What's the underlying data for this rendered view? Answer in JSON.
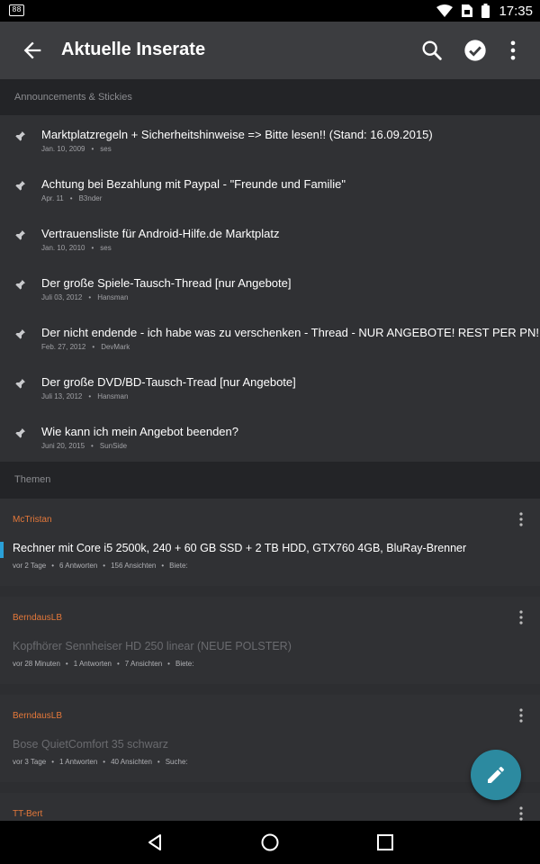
{
  "status_bar": {
    "left_icon": "88",
    "time": "17:35",
    "icons": [
      "wifi-icon",
      "sim-icon",
      "battery-icon"
    ]
  },
  "app_bar": {
    "title": "Aktuelle Inserate",
    "actions": [
      "search-icon",
      "check-circle-icon",
      "more-vert-icon"
    ]
  },
  "announcements": {
    "header": "Announcements & Stickies",
    "items": [
      {
        "title": "Marktplatzregeln + Sicherheitshinweise => Bitte lesen!! (Stand: 16.09.2015)",
        "date": "Jan. 10, 2009",
        "author": "ses"
      },
      {
        "title": "Achtung bei Bezahlung mit Paypal -  \"Freunde und Familie\"",
        "date": "Apr. 11",
        "author": "B3nder"
      },
      {
        "title": "Vertrauensliste für Android-Hilfe.de Marktplatz",
        "date": "Jan. 10, 2010",
        "author": "ses"
      },
      {
        "title": "Der große Spiele-Tausch-Thread [nur Angebote]",
        "date": "Juli 03, 2012",
        "author": "Hansman"
      },
      {
        "title": "Der nicht endende - ich habe was zu verschenken - Thread - NUR ANGEBOTE! REST PER PN!",
        "date": "Feb. 27, 2012",
        "author": "DevMark"
      },
      {
        "title": "Der große DVD/BD-Tausch-Tread [nur Angebote]",
        "date": "Juli 13, 2012",
        "author": "Hansman"
      },
      {
        "title": "Wie kann ich mein Angebot beenden?",
        "date": "Juni 20, 2015",
        "author": "SunSide"
      }
    ]
  },
  "themes": {
    "header": "Themen",
    "items": [
      {
        "author": "McTristan",
        "title": "Rechner mit Core i5 2500k, 240 + 60 GB SSD + 2 TB HDD, GTX760 4GB, BluRay-Brenner",
        "age": "vor 2 Tage",
        "replies": "6 Antworten",
        "views": "156 Ansichten",
        "type": "Biete:",
        "read": false
      },
      {
        "author": "BerndausLB",
        "title": "Kopfhörer Sennheiser HD 250 linear (NEUE POLSTER)",
        "age": "vor 28 Minuten",
        "replies": "1 Antworten",
        "views": "7 Ansichten",
        "type": "Biete:",
        "read": true
      },
      {
        "author": "BerndausLB",
        "title": "Bose QuietComfort 35 schwarz",
        "age": "vor 3 Tage",
        "replies": "1 Antworten",
        "views": "40 Ansichten",
        "type": "Suche:",
        "read": true
      },
      {
        "author": "TT-Bert",
        "title": "",
        "age": "",
        "replies": "",
        "views": "",
        "type": "",
        "read": false
      }
    ]
  },
  "fab": {
    "icon": "pencil-icon"
  },
  "nav_bar": {
    "buttons": [
      "back-triangle-icon",
      "home-circle-icon",
      "recents-square-icon"
    ]
  },
  "colors": {
    "app_bar": "#3c3d40",
    "background": "#2d2e31",
    "author": "#e4783a",
    "unread_marker": "#2aa0d8",
    "fab": "#2c8aa0"
  }
}
